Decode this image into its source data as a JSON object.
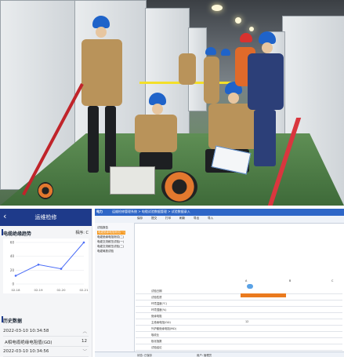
{
  "phone": {
    "title": "运维检修",
    "back_icon": "chevron-left-icon",
    "trend_title": "电缆绝缘趋势",
    "trend_select": "相序: C",
    "history_title": "历史数据",
    "chart_data": {
      "type": "line",
      "categories": [
        "02-18",
        "02-19",
        "02-20",
        "02-21"
      ],
      "values": [
        12,
        28,
        22,
        60
      ],
      "ylim": [
        0,
        60
      ],
      "yticks": [
        0,
        20,
        40,
        60
      ],
      "color": "#4a6cf7",
      "grid": true
    },
    "history": [
      {
        "text": "2022-03-10 10:34:58",
        "value": ""
      },
      {
        "text": "A相电缆绝缘电阻值(GΩ)",
        "value": "12"
      },
      {
        "text": "2022-03-10 10:34:56",
        "value": ""
      }
    ]
  },
  "desktop": {
    "brand": "电力",
    "header": "运维检修管理系统 > 电缆试验数据管理 > 试验数据录入",
    "tabs": [
      "保存",
      "提交",
      "打印",
      "刷新",
      "导出",
      "导入"
    ],
    "tree": [
      {
        "label": "试验报告",
        "selected": false
      },
      {
        "label": "电缆绝缘电阻测试(一)",
        "selected": true
      },
      {
        "label": "电缆绝缘电阻测试(二)",
        "selected": false
      },
      {
        "label": "电缆交流耐压试验(一)",
        "selected": false
      },
      {
        "label": "电缆交流耐压试验(二)",
        "selected": false
      },
      {
        "label": "电缆局放试验",
        "selected": false
      }
    ],
    "columns": [
      "A",
      "B",
      "C"
    ],
    "rows": [
      {
        "label": "试验日期",
        "values": [
          "",
          "",
          ""
        ]
      },
      {
        "label": "试验性质",
        "values": [
          "",
          "",
          ""
        ]
      },
      {
        "label": "环境温度(℃)",
        "values": [
          "",
          "",
          ""
        ]
      },
      {
        "label": "环境湿度(%)",
        "values": [
          "",
          "",
          ""
        ]
      },
      {
        "label": "绝缘电阻",
        "values": [
          "",
          "",
          ""
        ]
      },
      {
        "label": "主绝缘电阻(GΩ)",
        "values": [
          "12",
          "",
          ""
        ]
      },
      {
        "label": "外护套绝缘电阻(MΩ)",
        "values": [
          "",
          "",
          ""
        ]
      },
      {
        "label": "吸收比",
        "values": [
          "",
          "",
          ""
        ]
      },
      {
        "label": "极化指数",
        "values": [
          "",
          "",
          ""
        ]
      },
      {
        "label": "试验结论",
        "values": [
          "",
          "",
          ""
        ]
      },
      {
        "label": "备注",
        "values": [
          "",
          "",
          ""
        ]
      }
    ],
    "status": [
      "状态: 已保存",
      "用户: 管理员"
    ]
  }
}
